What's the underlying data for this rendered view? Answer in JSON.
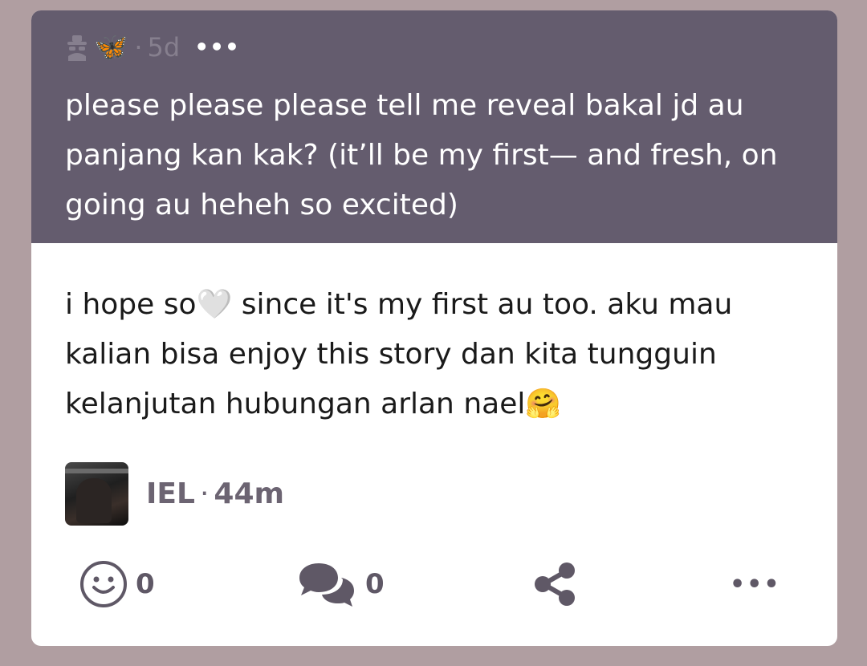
{
  "quoted_comment": {
    "anon_icon": "anonymous-user-icon",
    "butterfly_emoji": "🦋",
    "separator": "·",
    "time": "5d",
    "more_label": "•••",
    "text": "please please please tell me reveal bakal jd au panjang kan kak? (it’ll be my first— and fresh, on going au heheh so excited)"
  },
  "reply": {
    "text": "i hope so🤍 since it's my first au too. aku mau kalian bisa enjoy this story dan kita tungguin kelanjutan hubungan arlan nael🤗",
    "author": "IEL",
    "separator": "·",
    "time": "44m"
  },
  "actions": {
    "reactions_count": "0",
    "replies_count": "0",
    "icons": [
      "smiley-icon",
      "chat-bubbles-icon",
      "share-icon",
      "more-icon"
    ],
    "more_label": "•••"
  },
  "colors": {
    "background": "#b09ea1",
    "quoted_bg": "#645c6e",
    "card_bg": "#ffffff",
    "icon_color": "#5f5866"
  }
}
